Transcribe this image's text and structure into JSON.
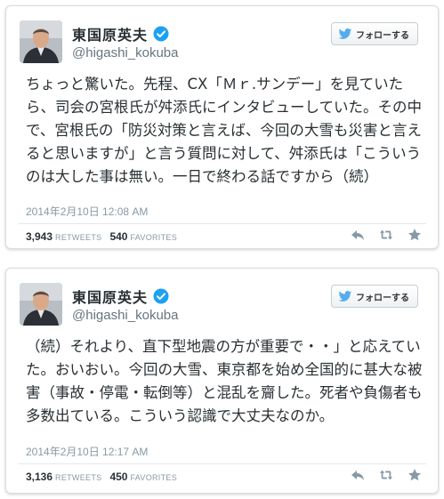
{
  "colors": {
    "verified": "#1da1f2",
    "twitter_bird": "#55acee",
    "action_icon": "#8899a6"
  },
  "tweets": [
    {
      "name": "東国原英夫",
      "handle": "@higashi_kokuba",
      "follow_label": "フォローする",
      "text": "ちょっと驚いた。先程、CX「Ｍｒ.サンデー」を見ていたら、司会の宮根氏が舛添氏にインタビューしていた。その中で、宮根氏の「防災対策と言えば、今回の大雪も災害と言えると思いますが」と言う質問に対して、舛添氏は「こういうのは大した事は無い。一日で終わる話ですから（続）",
      "timestamp": "2014年2月10日 12:08 AM",
      "retweets": "3,943",
      "retweets_label": "RETWEETS",
      "favorites": "540",
      "favorites_label": "FAVORITES"
    },
    {
      "name": "東国原英夫",
      "handle": "@higashi_kokuba",
      "follow_label": "フォローする",
      "text": "（続）それより、直下型地震の方が重要で・・」と応えていた。おいおい。今回の大雪、東京都を始め全国的に甚大な被害（事故・停電・転倒等）と混乱を齎した。死者や負傷者も多数出ている。こういう認識で大丈夫なのか。",
      "timestamp": "2014年2月10日 12:17 AM",
      "retweets": "3,136",
      "retweets_label": "RETWEETS",
      "favorites": "450",
      "favorites_label": "FAVORITES"
    }
  ]
}
